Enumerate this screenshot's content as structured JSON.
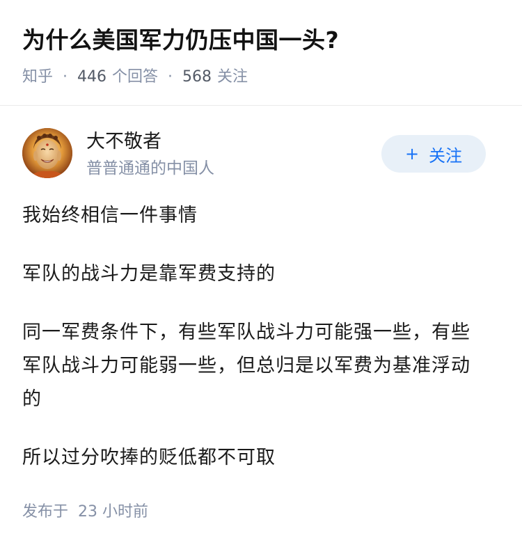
{
  "question": {
    "title": "为什么美国军力仍压中国一头?",
    "site": "知乎",
    "separator": "·",
    "answers_count": "446",
    "answers_label": "个回答",
    "followers_count": "568",
    "followers_label": "关注"
  },
  "author": {
    "avatar_icon": "buddha-avatar-icon",
    "name": "大不敬者",
    "bio": "普普通通的中国人",
    "follow_plus": "+",
    "follow_label": "关注"
  },
  "answer": {
    "paragraphs": [
      "我始终相信一件事情",
      "军队的战斗力是靠军费支持的",
      "同一军费条件下，有些军队战斗力可能强一些，有些军队战斗力可能弱一些，但总归是以军费为基准浮动的",
      "所以过分吹捧的贬低都不可取"
    ],
    "publish_prefix": "发布于",
    "publish_time": "23 小时前"
  },
  "colors": {
    "accent": "#1772f6",
    "meta_gray": "#8590a6",
    "follow_bg": "#e8f0f8"
  }
}
